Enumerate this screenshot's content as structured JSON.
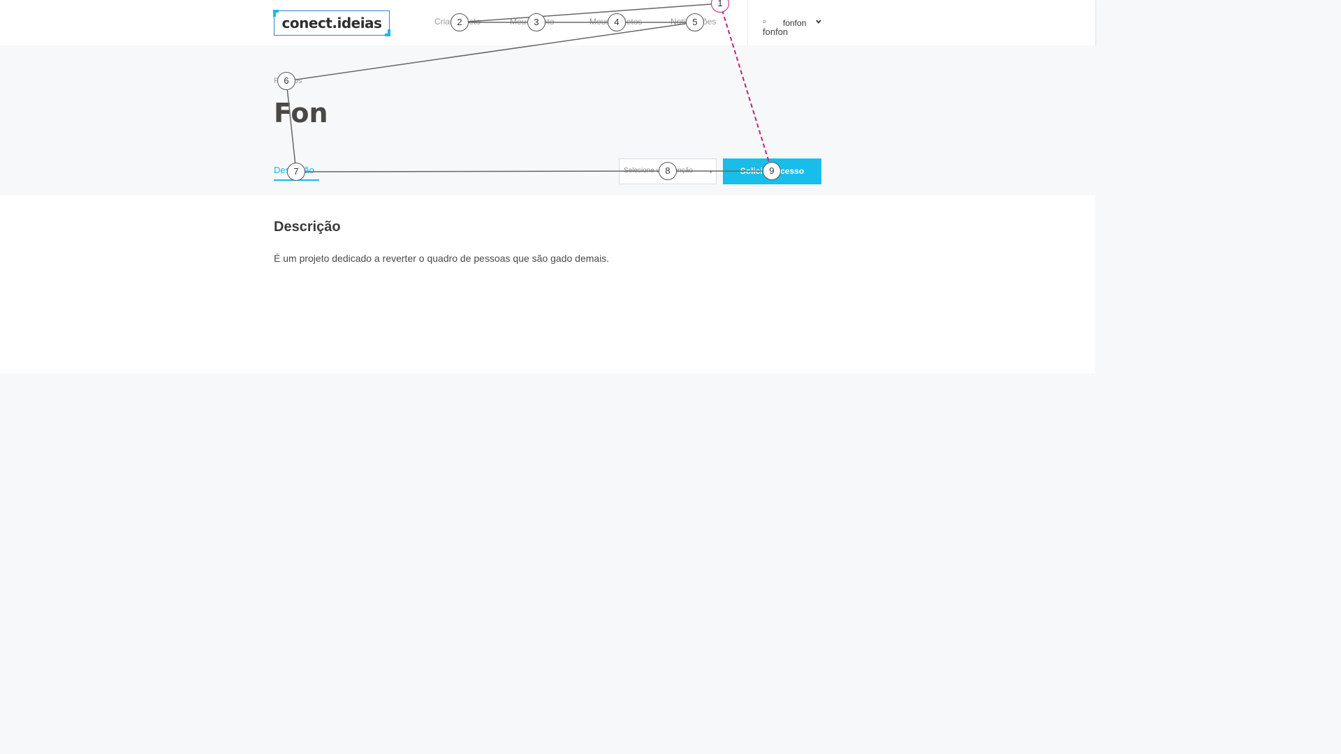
{
  "header": {
    "logo": "conect.ideias",
    "nav": [
      "Criar projeto",
      "Meu projeto",
      "Meus projetos",
      "Notificações"
    ],
    "user": {
      "avatar_alt": "fonfon",
      "name": "fonfon"
    }
  },
  "hero": {
    "breadcrumb": "Projetos",
    "title": "Fon",
    "tab": "Descrição",
    "select_placeholder": "Selecione uma função",
    "cta": "Solicitar acesso"
  },
  "content": {
    "section_title": "Descrição",
    "section_body": "É um projeto dedicado a reverter o quadro de pessoas que são gado demais."
  },
  "markers": [
    "1",
    "2",
    "3",
    "4",
    "5",
    "6",
    "7",
    "8",
    "9"
  ],
  "colors": {
    "accent": "#18bde9",
    "trace": "#666666",
    "trace_highlight": "#c02079"
  }
}
